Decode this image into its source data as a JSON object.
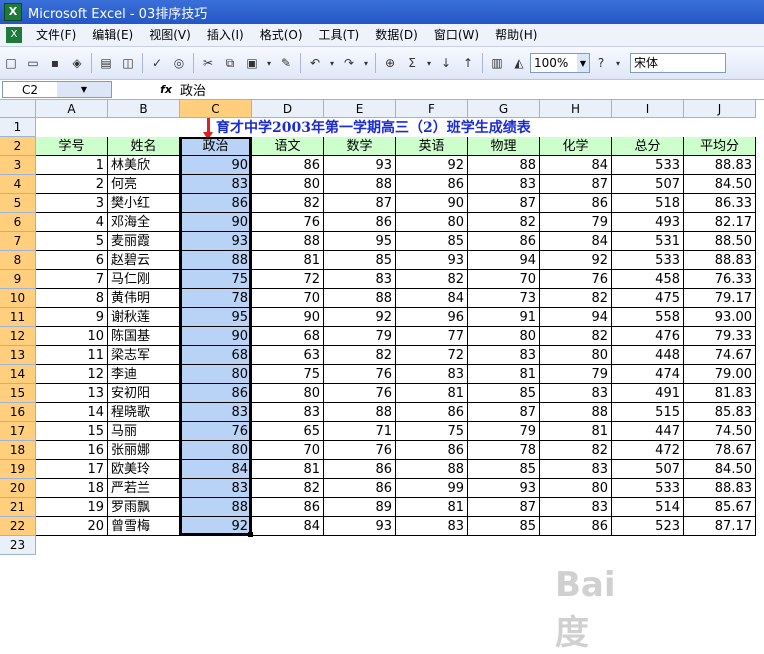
{
  "window": {
    "title": "Microsoft Excel - 03排序技巧"
  },
  "menu": [
    "文件(F)",
    "编辑(E)",
    "视图(V)",
    "插入(I)",
    "格式(O)",
    "工具(T)",
    "数据(D)",
    "窗口(W)",
    "帮助(H)"
  ],
  "toolbar": {
    "zoom": "100%",
    "font": "宋体"
  },
  "formula": {
    "cell_ref": "C2",
    "fx": "fx",
    "value": "政治"
  },
  "columns": [
    "A",
    "B",
    "C",
    "D",
    "E",
    "F",
    "G",
    "H",
    "I",
    "J"
  ],
  "rows": [
    "1",
    "2",
    "3",
    "4",
    "5",
    "6",
    "7",
    "8",
    "9",
    "10",
    "11",
    "12",
    "13",
    "14",
    "15",
    "16",
    "17",
    "18",
    "19",
    "20",
    "21",
    "22",
    "23"
  ],
  "sheet": {
    "title": "育才中学2003年第一学期高三（2）班学生成绩表",
    "headers": [
      "学号",
      "姓名",
      "政治",
      "语文",
      "数学",
      "英语",
      "物理",
      "化学",
      "总分",
      "平均分"
    ],
    "data": [
      [
        "1",
        "林美欣",
        "90",
        "86",
        "93",
        "92",
        "88",
        "84",
        "533",
        "88.83"
      ],
      [
        "2",
        "何亮",
        "83",
        "80",
        "88",
        "86",
        "83",
        "87",
        "507",
        "84.50"
      ],
      [
        "3",
        "樊小红",
        "86",
        "82",
        "87",
        "90",
        "87",
        "86",
        "518",
        "86.33"
      ],
      [
        "4",
        "邓海全",
        "90",
        "76",
        "86",
        "80",
        "82",
        "79",
        "493",
        "82.17"
      ],
      [
        "5",
        "麦丽霞",
        "93",
        "88",
        "95",
        "85",
        "86",
        "84",
        "531",
        "88.50"
      ],
      [
        "6",
        "赵碧云",
        "88",
        "81",
        "85",
        "93",
        "94",
        "92",
        "533",
        "88.83"
      ],
      [
        "7",
        "马仁刚",
        "75",
        "72",
        "83",
        "82",
        "70",
        "76",
        "458",
        "76.33"
      ],
      [
        "8",
        "黄伟明",
        "78",
        "70",
        "88",
        "84",
        "73",
        "82",
        "475",
        "79.17"
      ],
      [
        "9",
        "谢秋莲",
        "95",
        "90",
        "92",
        "96",
        "91",
        "94",
        "558",
        "93.00"
      ],
      [
        "10",
        "陈国基",
        "90",
        "68",
        "79",
        "77",
        "80",
        "82",
        "476",
        "79.33"
      ],
      [
        "11",
        "梁志军",
        "68",
        "63",
        "82",
        "72",
        "83",
        "80",
        "448",
        "74.67"
      ],
      [
        "12",
        "李迪",
        "80",
        "75",
        "76",
        "83",
        "81",
        "79",
        "474",
        "79.00"
      ],
      [
        "13",
        "安初阳",
        "86",
        "80",
        "76",
        "81",
        "85",
        "83",
        "491",
        "81.83"
      ],
      [
        "14",
        "程晓歌",
        "83",
        "83",
        "88",
        "86",
        "87",
        "88",
        "515",
        "85.83"
      ],
      [
        "15",
        "马丽",
        "76",
        "65",
        "71",
        "75",
        "79",
        "81",
        "447",
        "74.50"
      ],
      [
        "16",
        "张丽娜",
        "80",
        "70",
        "76",
        "86",
        "78",
        "82",
        "472",
        "78.67"
      ],
      [
        "17",
        "欧美玲",
        "84",
        "81",
        "86",
        "88",
        "85",
        "83",
        "507",
        "84.50"
      ],
      [
        "18",
        "严若兰",
        "83",
        "82",
        "86",
        "99",
        "93",
        "80",
        "533",
        "88.83"
      ],
      [
        "19",
        "罗雨飘",
        "88",
        "86",
        "89",
        "81",
        "87",
        "83",
        "514",
        "85.67"
      ],
      [
        "20",
        "曾雪梅",
        "92",
        "84",
        "93",
        "83",
        "85",
        "86",
        "523",
        "87.17"
      ]
    ]
  },
  "watermark": "Bai度"
}
